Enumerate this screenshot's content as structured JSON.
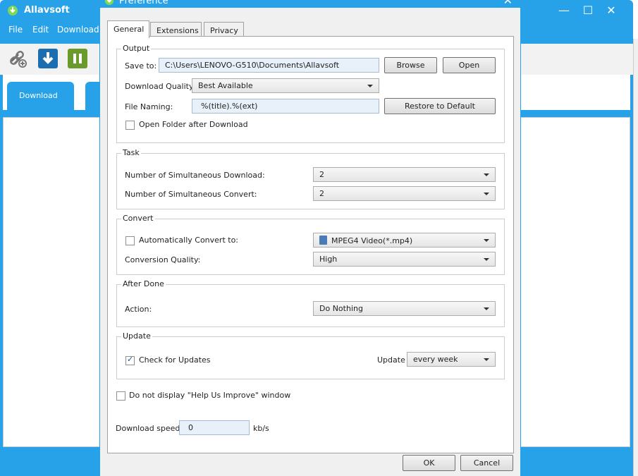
{
  "app": {
    "title": "Allavsoft",
    "menu": [
      "File",
      "Edit",
      "Download"
    ],
    "tabs": [
      "Download"
    ],
    "window_controls": {
      "minimize": "—",
      "maximize": "☐",
      "close": "✕"
    },
    "toolbar_icons": [
      "add-link-icon",
      "download-icon",
      "pause-icon"
    ],
    "colors": {
      "accent": "#27a1e8",
      "pause": "#6a9a2a",
      "download_btn": "#1b6fb0"
    }
  },
  "dialog": {
    "title": "Preference",
    "close": "✕",
    "tabs": [
      "General",
      "Extensions",
      "Privacy"
    ],
    "output": {
      "legend": "Output",
      "save_to_label": "Save to:",
      "save_to_value": "C:\\Users\\LENOVO-G510\\Documents\\Allavsoft",
      "browse": "Browse",
      "open": "Open",
      "quality_label": "Download Quality:",
      "quality_value": "Best Available",
      "naming_label": "File Naming:",
      "naming_value": "%(title).%(ext)",
      "restore": "Restore to Default",
      "open_folder_label": "Open Folder after Download",
      "open_folder_checked": false
    },
    "task": {
      "legend": "Task",
      "sim_download_label": "Number of Simultaneous Download:",
      "sim_download_value": "2",
      "sim_convert_label": "Number of Simultaneous Convert:",
      "sim_convert_value": "2"
    },
    "convert": {
      "legend": "Convert",
      "auto_label": "Automatically Convert to:",
      "auto_checked": false,
      "format_value": "MPEG4 Video(*.mp4)",
      "quality_label": "Conversion Quality:",
      "quality_value": "High"
    },
    "after_done": {
      "legend": "After Done",
      "action_label": "Action:",
      "action_value": "Do Nothing"
    },
    "update": {
      "legend": "Update",
      "check_label": "Check for Updates",
      "check_checked": true,
      "update_label": "Update",
      "update_value": "every week"
    },
    "help_improve_label": "Do not display \"Help Us Improve\" window",
    "help_improve_checked": false,
    "speed_label": "Download speed:",
    "speed_value": "0",
    "speed_unit": "kb/s",
    "ok": "OK",
    "cancel": "Cancel"
  }
}
